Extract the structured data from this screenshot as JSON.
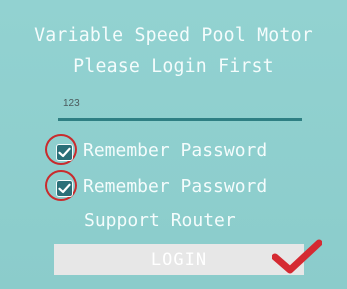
{
  "header": {
    "title_line_1": "Variable Speed Pool Motor",
    "title_line_2": "Please Login First"
  },
  "form": {
    "password_value": "123",
    "remember_password_label": "Remember Password",
    "remember_password_label_2": "Remember Password",
    "support_router_label": "Support Router",
    "login_label": "LOGIN",
    "remember_password_checked": true,
    "remember_password_2_checked": true
  },
  "annotations": {
    "highlight_circle_color": "#c92b2d",
    "checkmark_color": "#d52a32",
    "checkmark_icon": "red-checkmark-icon"
  },
  "colors": {
    "background": "#8fd0cf",
    "field_underline": "#2e7f83",
    "checkbox_fill": "#2b6f78",
    "button_background": "#e7e7e7",
    "text": "#f4fcfc"
  }
}
